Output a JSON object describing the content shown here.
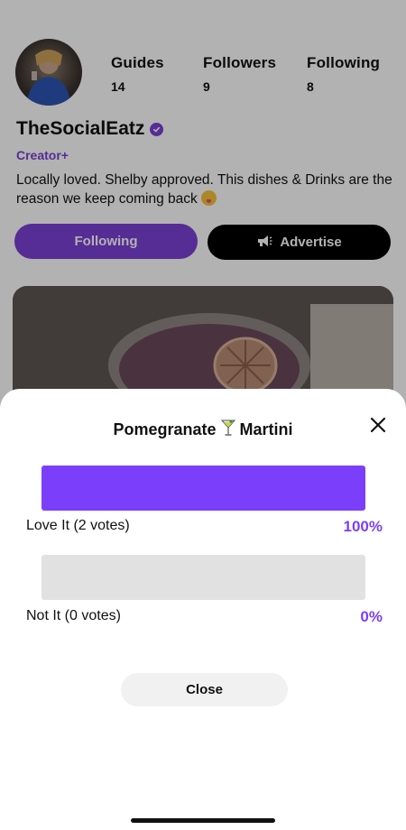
{
  "profile": {
    "name": "TheSocialEatz",
    "badge": "Creator+",
    "bio_text": "Locally loved. Shelby approved. This dishes & Drinks are the reason we keep coming back",
    "stats": [
      {
        "label": "Guides",
        "count": "14"
      },
      {
        "label": "Followers",
        "count": "9"
      },
      {
        "label": "Following",
        "count": "8"
      }
    ],
    "following_button": "Following",
    "advertise_button": "Advertise"
  },
  "poll": {
    "title_part1": "Pomegranate",
    "title_part2": "Martini",
    "options": [
      {
        "label": "Love It (2 votes)",
        "percent": "100%",
        "fraction": 1.0
      },
      {
        "label": "Not It (0 votes)",
        "percent": "0%",
        "fraction": 0.0
      }
    ],
    "close_button": "Close"
  },
  "colors": {
    "accent": "#7b3fd6",
    "bar_fill": "#7b3ffc",
    "bar_track": "#e1e1e1"
  },
  "icons": [
    "verified-check-icon",
    "megaphone-icon",
    "martini-glass-icon",
    "close-x-icon",
    "smiling-face-emoji"
  ]
}
